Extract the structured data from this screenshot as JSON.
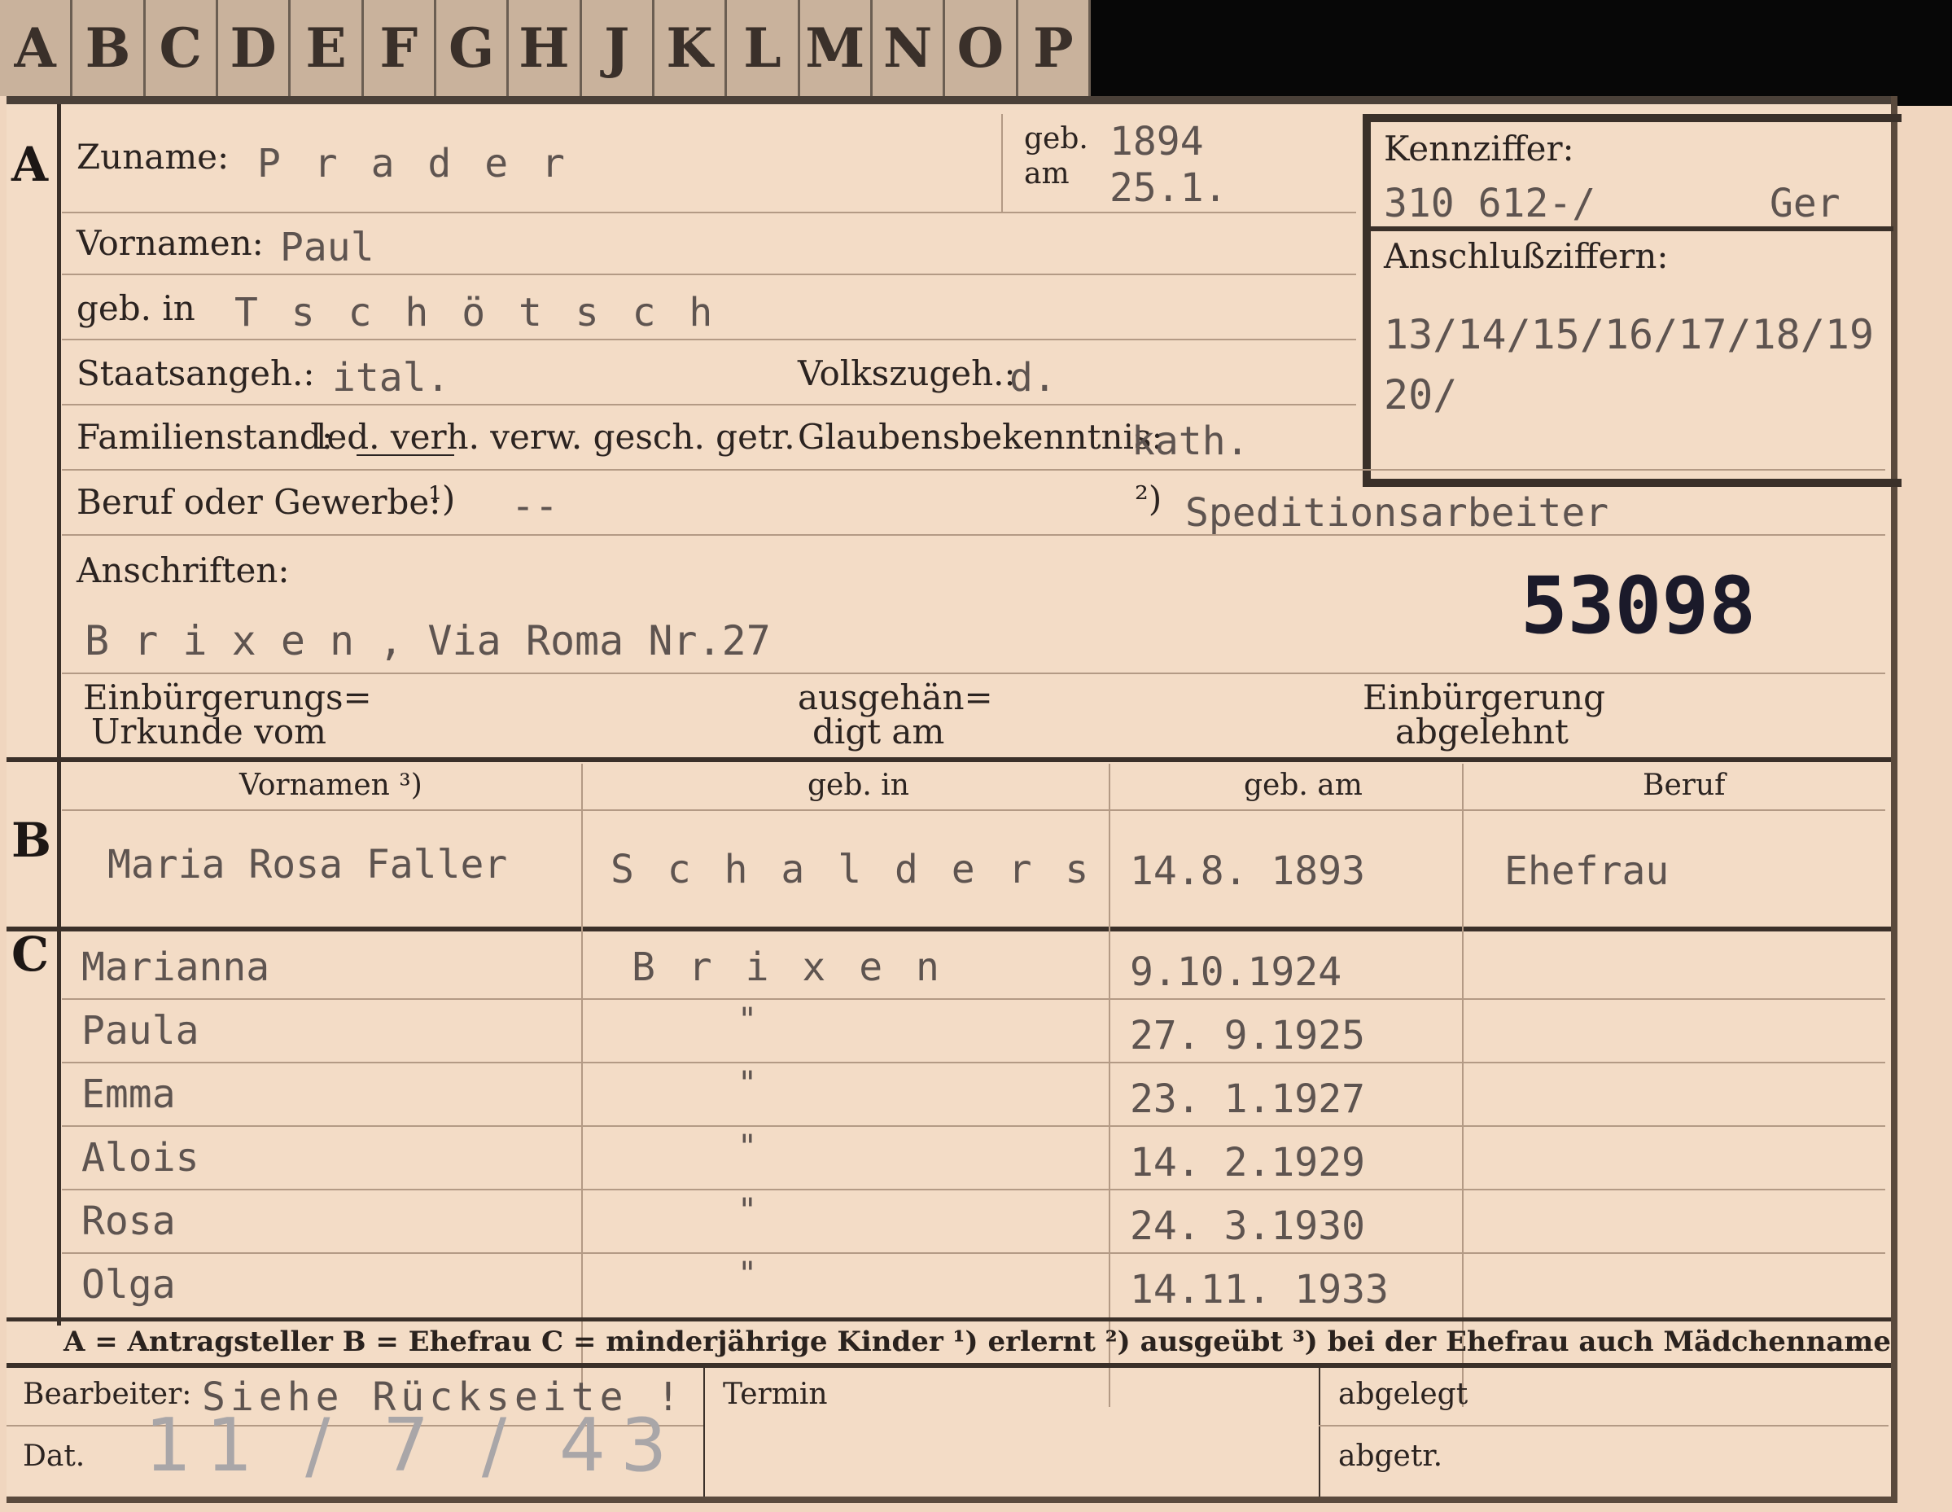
{
  "index_tabs": [
    "A",
    "B",
    "C",
    "D",
    "E",
    "F",
    "G",
    "H",
    "J",
    "K",
    "L",
    "M",
    "N",
    "O",
    "P"
  ],
  "header": {
    "surname_label": "Zuname:",
    "surname": "P r a d e r",
    "birth_label_1": "geb.",
    "birth_label_2": "am",
    "birth_year": "1894",
    "birth_date": "25.1.",
    "kennziffer_label": "Kennziffer:",
    "kennziffer_value": "310 612-/",
    "kennziffer_suffix": "Ger",
    "anschluss_label": "Anschlußziffern:",
    "anschluss_line1": "13/14/15/16/17/18/19",
    "anschluss_line2": "20/",
    "first_names_label": "Vornamen:",
    "first_names": "Paul",
    "birthplace_label": "geb. in",
    "birthplace": "T s c h ö t s c h",
    "citizenship_label": "Staatsangeh.:",
    "citizenship": "ital.",
    "ethnicity_label": "Volkszugeh.:",
    "ethnicity": "d.",
    "family_label": "Familienstand:",
    "family_options": "led. verh. verw. gesch. getr.",
    "religion_label": "Glaubensbekenntnis:",
    "religion": "kath.",
    "profession_label": "Beruf oder Gewerbe:",
    "profession_learned_mark": "¹)",
    "profession_learned": "--",
    "profession_practiced_mark": "²)",
    "profession_practiced": "Speditionsarbeiter",
    "address_label": "Anschriften:",
    "address": "B r i x e n , Via Roma Nr.27",
    "card_number": "53098",
    "naturalization_doc_label_1": "Einbürgerungs=",
    "naturalization_doc_label_2": "Urkunde vom",
    "handed_out_label_1": "ausgehän=",
    "handed_out_label_2": "digt am",
    "naturalization_rejected_label_1": "Einbürgerung",
    "naturalization_rejected_label_2": "abgelehnt"
  },
  "sections": {
    "a": "A",
    "b": "B",
    "c": "C"
  },
  "spouse_table": {
    "headers": [
      "Vornamen ³)",
      "geb. in",
      "geb. am",
      "Beruf"
    ],
    "row": [
      "Maria Rosa Faller",
      "S c h a l d e r s",
      "14.8. 1893",
      "Ehefrau"
    ]
  },
  "children": [
    {
      "name": "Marianna",
      "place": "B r i x e n",
      "date": "9.10.1924"
    },
    {
      "name": "Paula",
      "place": "\"",
      "date": "27. 9.1925"
    },
    {
      "name": "Emma",
      "place": "\"",
      "date": "23. 1.1927"
    },
    {
      "name": "Alois",
      "place": "\"",
      "date": "14. 2.1929"
    },
    {
      "name": "Rosa",
      "place": "\"",
      "date": "24. 3.1930"
    },
    {
      "name": "Olga",
      "place": "\"",
      "date": "14.11. 1933"
    }
  ],
  "legend": "A = Antragsteller   B = Ehefrau   C = minderjährige Kinder   ¹) erlernt   ²) ausgeübt   ³) bei der Ehefrau auch Mädchenname",
  "footer": {
    "processor_label": "Bearbeiter:",
    "processor_value": "Siehe Rückseite !",
    "date_label": "Dat.",
    "date_value": "11 / 7 / 43",
    "deadline_label": "Termin",
    "filed_label": "abgelegt",
    "dispatched_label": "abgetr."
  },
  "colors": {
    "paper": "#f3dcc6",
    "rule": "#3a3029",
    "ink_typed": "#5e5450"
  }
}
